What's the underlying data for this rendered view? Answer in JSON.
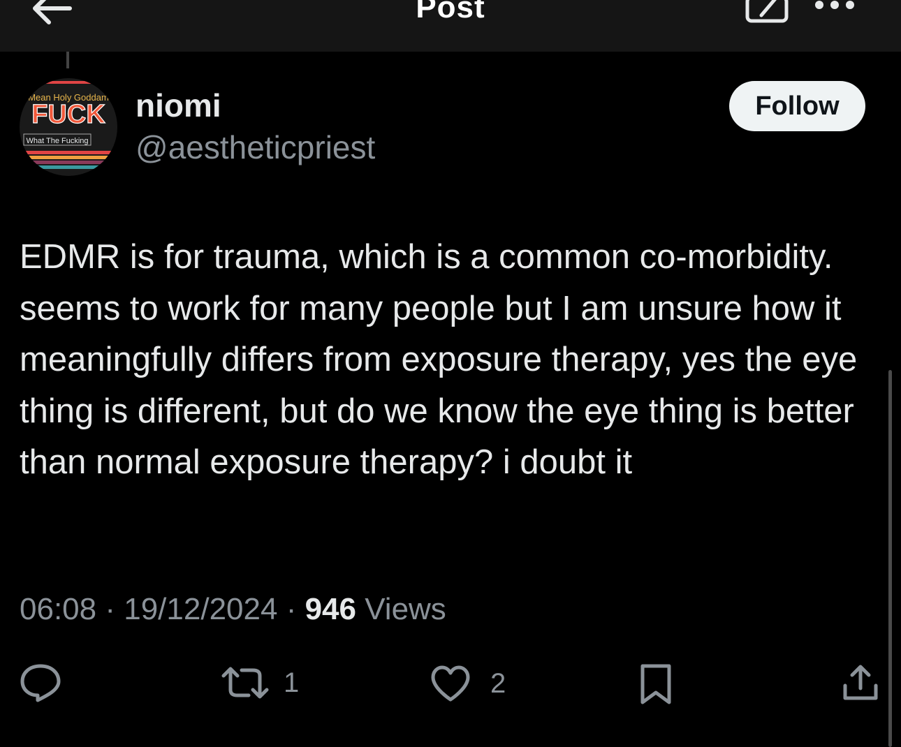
{
  "header": {
    "title": "Post",
    "back_icon": "arrow-left-icon",
    "compose_icon": "compose-icon",
    "more_icon": "more-horizontal-icon"
  },
  "author": {
    "name": "niomi",
    "handle": "@aestheticpriest",
    "avatar_text": {
      "line1": "Mean Holy Goddam",
      "line2": "FUCK",
      "line3": "What The Fucking"
    }
  },
  "follow_label": "Follow",
  "post": {
    "text": "EDMR is for trauma, which is a common co-morbidity. seems to work for many people but I am unsure how it meaningfully differs from exposure therapy, yes the eye thing is different, but do we know the eye thing is better than normal exposure therapy? i doubt it",
    "time": "06:08",
    "separator": "·",
    "date": "19/12/2024",
    "views_count": "946",
    "views_label": "Views"
  },
  "actions": {
    "reply_icon": "reply-icon",
    "retweet_icon": "retweet-icon",
    "retweet_count": "1",
    "like_icon": "heart-icon",
    "like_count": "2",
    "bookmark_icon": "bookmark-icon",
    "share_icon": "share-icon"
  },
  "colors": {
    "background": "#000000",
    "text": "#e7e9ea",
    "secondary_text": "#8b9299",
    "follow_bg": "#eff3f4"
  }
}
